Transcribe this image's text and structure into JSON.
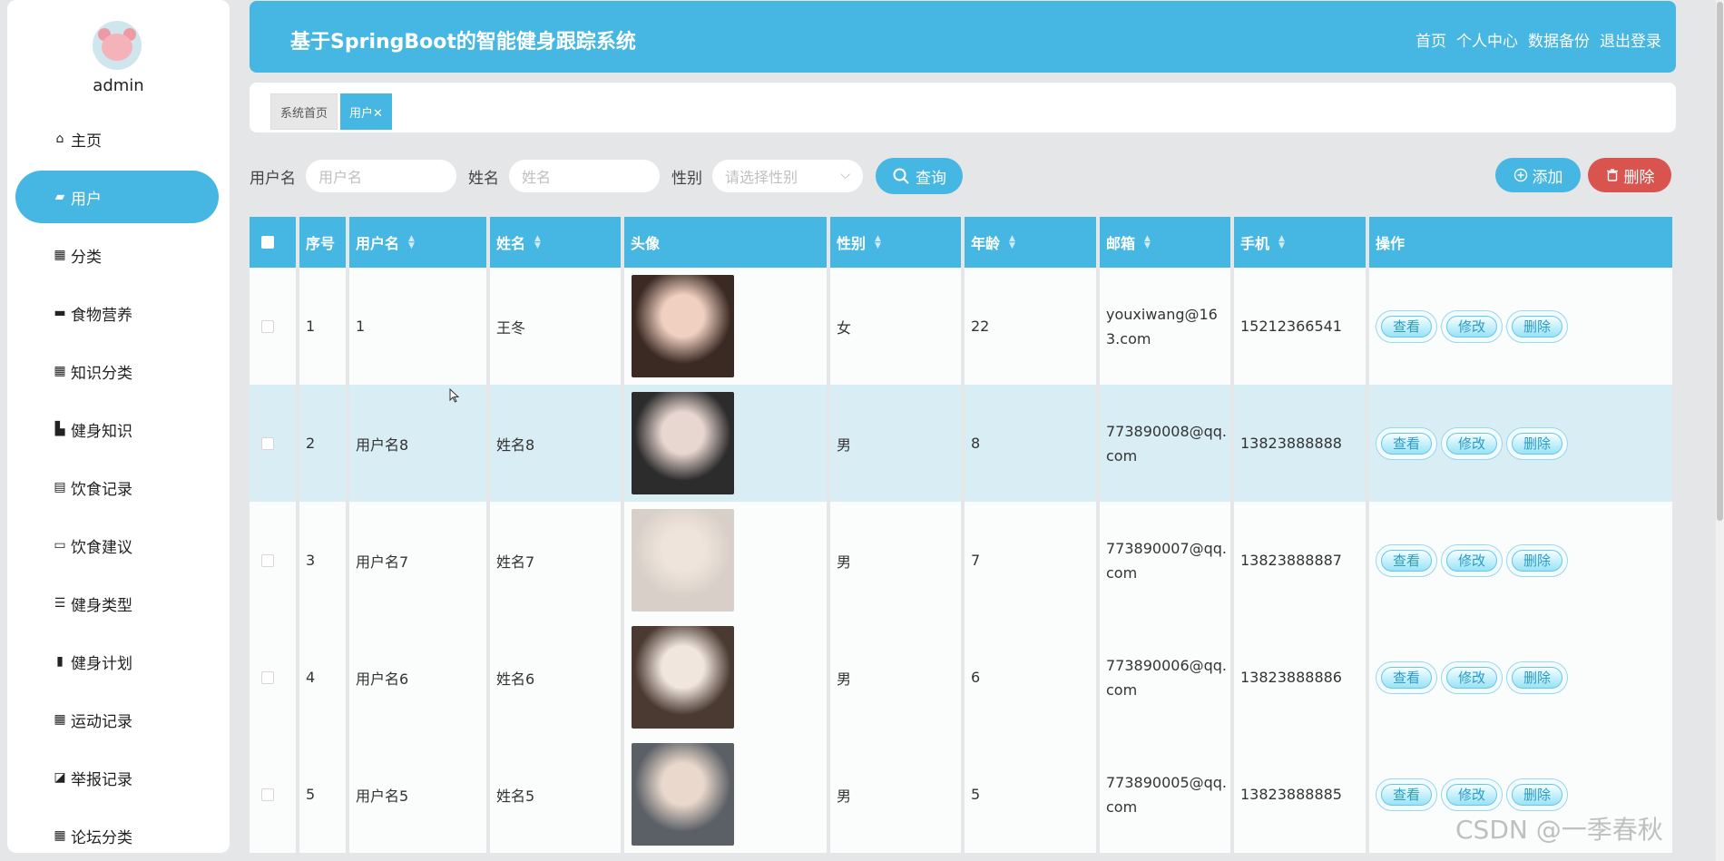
{
  "user": {
    "name": "admin"
  },
  "sidebar": {
    "items": [
      {
        "label": "主页",
        "icon": "home-icon",
        "glyph": "⌂",
        "active": false
      },
      {
        "label": "用户",
        "icon": "user-card-icon",
        "glyph": "▰",
        "active": true
      },
      {
        "label": "分类",
        "icon": "grid-icon",
        "glyph": "▦",
        "active": false
      },
      {
        "label": "食物营养",
        "icon": "briefcase-icon",
        "glyph": "▬",
        "active": false
      },
      {
        "label": "知识分类",
        "icon": "grid-icon",
        "glyph": "▦",
        "active": false
      },
      {
        "label": "健身知识",
        "icon": "folder-icon",
        "glyph": "▙",
        "active": false
      },
      {
        "label": "饮食记录",
        "icon": "clipboard-icon",
        "glyph": "▤",
        "active": false
      },
      {
        "label": "饮食建议",
        "icon": "monitor-icon",
        "glyph": "▭",
        "active": false
      },
      {
        "label": "健身类型",
        "icon": "sliders-icon",
        "glyph": "☰",
        "active": false
      },
      {
        "label": "健身计划",
        "icon": "bar-chart-icon",
        "glyph": "▮",
        "active": false
      },
      {
        "label": "运动记录",
        "icon": "grid-icon",
        "glyph": "▦",
        "active": false
      },
      {
        "label": "举报记录",
        "icon": "line-chart-icon",
        "glyph": "◪",
        "active": false
      },
      {
        "label": "论坛分类",
        "icon": "grid-icon",
        "glyph": "▦",
        "active": false
      }
    ]
  },
  "header": {
    "title": "基于SpringBoot的智能健身跟踪系统",
    "nav": [
      "首页",
      "个人中心",
      "数据备份",
      "退出登录"
    ]
  },
  "tabs": {
    "home": "系统首页",
    "current": "用户✕"
  },
  "search": {
    "username_label": "用户名",
    "username_placeholder": "用户名",
    "name_label": "姓名",
    "name_placeholder": "姓名",
    "gender_label": "性别",
    "gender_placeholder": "请选择性别",
    "query_button": "查询",
    "add_button": "添加",
    "delete_button": "删除"
  },
  "table": {
    "headers": {
      "index": "序号",
      "username": "用户名",
      "name": "姓名",
      "avatar": "头像",
      "gender": "性别",
      "age": "年龄",
      "email": "邮箱",
      "phone": "手机",
      "actions": "操作"
    },
    "action_labels": {
      "view": "查看",
      "edit": "修改",
      "delete": "删除"
    },
    "rows": [
      {
        "index": "1",
        "username": "1",
        "name": "王冬",
        "gender": "女",
        "age": "22",
        "email": "youxiwang@163.com",
        "phone": "15212366541"
      },
      {
        "index": "2",
        "username": "用户名8",
        "name": "姓名8",
        "gender": "男",
        "age": "8",
        "email": "773890008@qq.com",
        "phone": "13823888888"
      },
      {
        "index": "3",
        "username": "用户名7",
        "name": "姓名7",
        "gender": "男",
        "age": "7",
        "email": "773890007@qq.com",
        "phone": "13823888887"
      },
      {
        "index": "4",
        "username": "用户名6",
        "name": "姓名6",
        "gender": "男",
        "age": "6",
        "email": "773890006@qq.com",
        "phone": "13823888886"
      },
      {
        "index": "5",
        "username": "用户名5",
        "name": "姓名5",
        "gender": "男",
        "age": "5",
        "email": "773890005@qq.com",
        "phone": "13823888885"
      }
    ]
  },
  "watermark": "CSDN @一季春秋",
  "colors": {
    "primary": "#45b7e2",
    "danger": "#d9534f",
    "highlight_row": "#d9edf5"
  }
}
